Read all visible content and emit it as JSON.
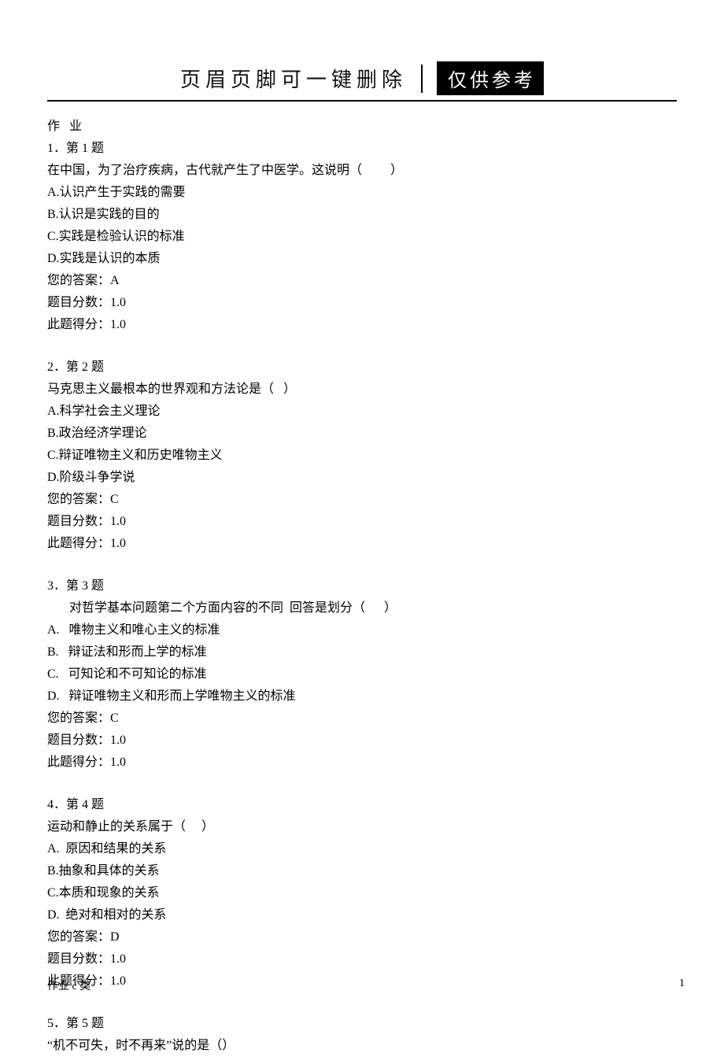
{
  "header": {
    "left_text": "页眉页脚可一键删除",
    "badge_text": "仅供参考"
  },
  "section_title": "作   业",
  "questions": [
    {
      "num_line": "1．第 1 题",
      "stem": "在中国，为了治疗疾病，古代就产生了中医学。这说明（         ）",
      "options": [
        "A.认识产生于实践的需要",
        "B.认识是实践的目的",
        "C.实践是检验认识的标准",
        "D.实践是认识的本质"
      ],
      "answer_line": "您的答案：A",
      "score_line": "题目分数：1.0",
      "got_line": "此题得分：1.0"
    },
    {
      "num_line": "2．第 2 题",
      "stem": "马克思主义最根本的世界观和方法论是（   ）",
      "options": [
        "A.科学社会主义理论",
        "B.政治经济学理论",
        "C.辩证唯物主义和历史唯物主义",
        "D.阶级斗争学说"
      ],
      "answer_line": "您的答案：C",
      "score_line": "题目分数：1.0",
      "got_line": "此题得分：1.0"
    },
    {
      "num_line": "3．第 3 题",
      "stem": "       对哲学基本问题第二个方面内容的不同  回答是划分（      ）",
      "options": [
        "A.   唯物主义和唯心主义的标准",
        "B.   辩证法和形而上学的标准",
        "C.   可知论和不可知论的标准",
        "D.   辩证唯物主义和形而上学唯物主义的标准"
      ],
      "answer_line": "您的答案：C",
      "score_line": "题目分数：1.0",
      "got_line": "此题得分：1.0"
    },
    {
      "num_line": "4．第 4 题",
      "stem": "运动和静止的关系属于（     ）",
      "options": [
        "A.  原因和结果的关系",
        "B.抽象和具体的关系",
        "C.本质和现象的关系",
        "D.  绝对和相对的关系"
      ],
      "answer_line": "您的答案：D",
      "score_line": "题目分数：1.0",
      "got_line": "此题得分：1.0"
    },
    {
      "num_line": "5．第 5 题",
      "stem": "“机不可失，时不再来”说的是（）",
      "options": [],
      "answer_line": "",
      "score_line": "",
      "got_line": ""
    }
  ],
  "footer": {
    "left": "作业 c 类",
    "right": "1"
  }
}
